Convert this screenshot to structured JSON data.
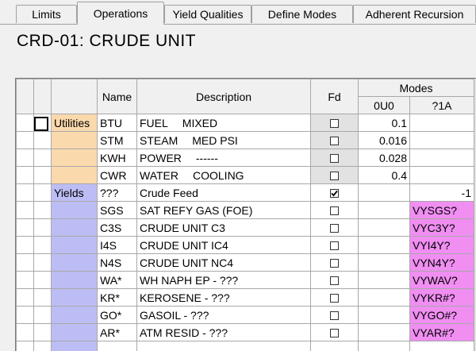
{
  "tabs": [
    {
      "label": "Limits",
      "active": false
    },
    {
      "label": "Operations",
      "active": true
    },
    {
      "label": "Yield Qualities",
      "active": false
    },
    {
      "label": "Define Modes",
      "active": false
    },
    {
      "label": "Adherent Recursion",
      "active": false
    }
  ],
  "title": "CRD-01: CRUDE UNIT",
  "grid": {
    "headers": {
      "name": "Name",
      "description": "Description",
      "fd": "Fd",
      "modes": "Modes",
      "mode1": "0U0",
      "mode2": "?1A"
    },
    "rows": [
      {
        "category": "Utilities",
        "name": "BTU",
        "desc_a": "FUEL",
        "desc_b": "MIXED",
        "fd": false,
        "m1": "0.1",
        "m2": ""
      },
      {
        "category": "",
        "name": "STM",
        "desc_a": "STEAM",
        "desc_b": "MED PSI",
        "fd": false,
        "m1": "0.016",
        "m2": ""
      },
      {
        "category": "",
        "name": "KWH",
        "desc_a": "POWER",
        "desc_b": "------",
        "fd": false,
        "m1": "0.028",
        "m2": ""
      },
      {
        "category": "",
        "name": "CWR",
        "desc_a": "WATER",
        "desc_b": "COOLING",
        "fd": false,
        "m1": "0.4",
        "m2": ""
      },
      {
        "category": "Yields",
        "name": "???",
        "desc_a": "Crude Feed",
        "desc_b": "",
        "fd": true,
        "m1": "",
        "m2": "-1"
      },
      {
        "category": "",
        "name": "SGS",
        "desc_a": "SAT REFY GAS  (FOE)",
        "desc_b": "",
        "fd": false,
        "m1": "",
        "m2": "VYSGS?"
      },
      {
        "category": "",
        "name": "C3S",
        "desc_a": "CRUDE UNIT C3",
        "desc_b": "",
        "fd": false,
        "m1": "",
        "m2": "VYC3Y?"
      },
      {
        "category": "",
        "name": "I4S",
        "desc_a": "CRUDE UNIT IC4",
        "desc_b": "",
        "fd": false,
        "m1": "",
        "m2": "VYI4Y?"
      },
      {
        "category": "",
        "name": "N4S",
        "desc_a": "CRUDE UNIT NC4",
        "desc_b": "",
        "fd": false,
        "m1": "",
        "m2": "VYN4Y?"
      },
      {
        "category": "",
        "name": "WA*",
        "desc_a": "WH NAPH  EP - ???",
        "desc_b": "",
        "fd": false,
        "m1": "",
        "m2": "VYWAV?"
      },
      {
        "category": "",
        "name": "KR*",
        "desc_a": "KEROSENE  - ???",
        "desc_b": "",
        "fd": false,
        "m1": "",
        "m2": "VYKR#?"
      },
      {
        "category": "",
        "name": "GO*",
        "desc_a": "GASOIL - ???",
        "desc_b": "",
        "fd": false,
        "m1": "",
        "m2": "VYGO#?"
      },
      {
        "category": "",
        "name": "AR*",
        "desc_a": "ATM RESID - ???",
        "desc_b": "",
        "fd": false,
        "m1": "",
        "m2": "VYAR#?"
      }
    ]
  },
  "colors": {
    "utilities": "#fad9ad",
    "yields": "#bdbdf5",
    "tag_cell": "#f08ef2",
    "fd_shaded": "#e2e2e2"
  }
}
